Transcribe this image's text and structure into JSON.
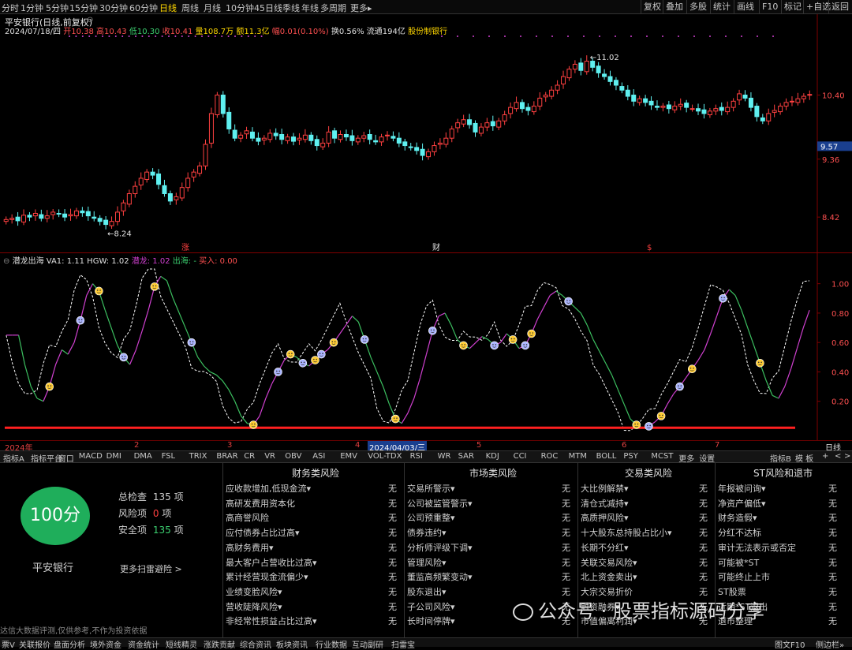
{
  "toolbar": {
    "periods": [
      "分时",
      "1分钟",
      "5分钟",
      "15分钟",
      "30分钟",
      "60分钟",
      "日线",
      "周线",
      "月线",
      "10分钟",
      "45日线",
      "季线",
      "年线",
      "多周期",
      "更多▸"
    ],
    "selected": "日线",
    "right_buttons": [
      "复权",
      "叠加",
      "多股",
      "统计",
      "画线",
      "F10",
      "标记",
      "+自选",
      "返回"
    ]
  },
  "quote": {
    "title": "平安银行(日线,前复权)",
    "date": "2024/07/18/四",
    "open": "开10.38",
    "high": "高10.43",
    "low": "低10.30",
    "close": "收10.41",
    "vol": "量108.7万",
    "amount": "额11.3亿",
    "change": "幅0.01(0.10%)",
    "turnover": "换0.56%",
    "float": "流通194亿",
    "sector": "股份制银行"
  },
  "price_axis": {
    "labels": [
      "10.40",
      "9.36",
      "8.42"
    ],
    "current": "9.57"
  },
  "annotations": {
    "max": "11.02",
    "min": "8.24",
    "events": [
      "涨",
      "财",
      "$"
    ]
  },
  "indicator": {
    "name": "潜龙出海",
    "va1": "VA1: 1.11",
    "hgw": "HGW: 1.02",
    "qianlong": "潜龙: 1.02",
    "chuhai": "出海: -",
    "buy": "买入: 0.00",
    "axis": [
      "1.00",
      "0.80",
      "0.60",
      "0.40",
      "0.20"
    ]
  },
  "xaxis": {
    "labels": [
      "2024年",
      "2",
      "3",
      "4",
      "2024/04/03/三",
      "5",
      "6",
      "7"
    ],
    "right": "日线"
  },
  "tabs": [
    "指标A",
    "指标平台",
    "窗口",
    "MACD",
    "DMI",
    "DMA",
    "FSL",
    "TRIX",
    "BRAR",
    "CR",
    "VR",
    "OBV",
    "ASI",
    "EMV",
    "VOL-TDX",
    "RSI",
    "WR",
    "SAR",
    "KDJ",
    "CCI",
    "ROC",
    "MTM",
    "BOLL",
    "PSY",
    "MCST",
    "更多",
    "设置"
  ],
  "tabs_right": [
    "指标B",
    "模 板",
    "+",
    "<",
    ">"
  ],
  "risk": {
    "score": "100分",
    "stock": "平安银行",
    "total_label": "总检查",
    "total": "135",
    "total_unit": "项",
    "risk_label": "风险项",
    "risk_count": "0",
    "risk_unit": "项",
    "safe_label": "安全项",
    "safe": "135",
    "safe_unit": "项",
    "more": "更多扫雷避险 >",
    "no": "无",
    "columns": [
      {
        "title": "财务类风险",
        "items": [
          "应收款增加,低现金流▾",
          "高研发费用资本化",
          "高商誉风险",
          "应付债券占比过高▾",
          "高财务费用▾",
          "最大客户占营收比过高▾",
          "累计经营现金流偏少▾",
          "业绩变脸风险▾",
          "营收陡降风险▾",
          "非经常性损益占比过高▾"
        ]
      },
      {
        "title": "市场类风险",
        "items": [
          "交易所警示▾",
          "公司被监管警示▾",
          "公司预重整▾",
          "债券违约▾",
          "分析师评级下调▾",
          "管理风险▾",
          "董监高频繁变动▾",
          "股东退出▾",
          "子公司风险▾",
          "长时间停牌▾"
        ]
      },
      {
        "title": "交易类风险",
        "items": [
          "大比例解禁▾",
          "清仓式减持▾",
          "高质押风险▾",
          "十大股东总持股占比小▾",
          "长期不分红▾",
          "关联交易风险▾",
          "北上资金卖出▾",
          "大宗交易折价",
          "融资融券▾",
          "市值偏离利润▾"
        ]
      },
      {
        "title": "ST风险和退市",
        "items": [
          "年报被问询▾",
          "净资产偏低▾",
          "财务造假▾",
          "分红不达标",
          "审计无法表示或否定",
          "可能被*ST",
          "可能终止上市",
          "ST股票",
          "近期*ST退出",
          "退市整理"
        ]
      }
    ]
  },
  "footer": {
    "disclaimer": "达信大数据评测,仅供参考,不作为投资依据",
    "items": [
      "票V",
      "关联报价",
      "盘面分析",
      "境外资金",
      "资金统计",
      "短线精灵",
      "涨跌贡献",
      "综合资讯",
      "板块资讯",
      "行业数据",
      "互动副研",
      "扫雷宝"
    ],
    "right": "图文F10",
    "right2": "侧边栏»"
  },
  "watermark": "公众号 · 股票指标源码分享",
  "chart_data": [
    {
      "type": "candlestick",
      "title": "平安银行(日线,前复权)",
      "ylim": [
        8.0,
        11.2
      ],
      "x": [
        "2024年",
        "2",
        "3",
        "4",
        "5",
        "6",
        "7"
      ],
      "y_ticks": [
        10.4,
        9.36,
        8.42
      ],
      "marked_high": 11.02,
      "marked_low": 8.24,
      "last_close": 10.41,
      "close": [
        8.38,
        8.4,
        8.36,
        8.45,
        8.42,
        8.48,
        8.4,
        8.44,
        8.5,
        8.47,
        8.42,
        8.46,
        8.52,
        8.49,
        8.44,
        8.4,
        8.35,
        8.3,
        8.35,
        8.5,
        8.65,
        8.8,
        8.92,
        9.05,
        9.15,
        9.1,
        8.95,
        8.8,
        8.68,
        8.75,
        8.9,
        9.05,
        9.15,
        9.25,
        9.6,
        10.1,
        10.4,
        10.1,
        9.85,
        9.7,
        9.75,
        9.82,
        9.7,
        9.65,
        9.7,
        9.78,
        9.74,
        9.68,
        9.72,
        9.65,
        9.7,
        9.75,
        9.66,
        9.58,
        9.62,
        9.8,
        9.7,
        9.76,
        9.72,
        9.66,
        9.7,
        9.74,
        9.68,
        9.64,
        9.72,
        9.75,
        9.7,
        9.62,
        9.58,
        9.55,
        9.5,
        9.42,
        9.48,
        9.58,
        9.62,
        9.7,
        9.85,
        9.95,
        10.0,
        9.92,
        9.8,
        9.88,
        9.95,
        9.9,
        9.98,
        10.08,
        10.2,
        10.28,
        10.18,
        10.15,
        10.22,
        10.35,
        10.4,
        10.48,
        10.56,
        10.7,
        10.82,
        10.9,
        10.8,
        10.95,
        10.85,
        10.76,
        10.7,
        10.62,
        10.56,
        10.48,
        10.38,
        10.3,
        10.34,
        10.28,
        10.24,
        10.2,
        10.22,
        10.18,
        10.22,
        10.25,
        10.2,
        10.18,
        10.14,
        10.1,
        10.14,
        10.18,
        10.15,
        10.2,
        10.3,
        10.42,
        10.35,
        10.2,
        10.05,
        9.98,
        10.1,
        10.15,
        10.22,
        10.28,
        10.3,
        10.34,
        10.38,
        10.41
      ]
    },
    {
      "type": "line",
      "title": "潜龙出海",
      "ylim": [
        0.0,
        1.1
      ],
      "y_ticks": [
        1.0,
        0.8,
        0.6,
        0.4,
        0.2
      ],
      "reference": 0.02,
      "series": [
        {
          "name": "VA1",
          "last": 1.11
        },
        {
          "name": "HGW",
          "last": 1.02
        },
        {
          "name": "潜龙",
          "last": 1.02
        }
      ],
      "values": [
        0.65,
        0.45,
        0.3,
        0.22,
        0.2,
        0.3,
        0.45,
        0.55,
        0.52,
        0.6,
        0.75,
        0.92,
        1.0,
        0.95,
        0.82,
        0.7,
        0.58,
        0.5,
        0.45,
        0.55,
        0.68,
        0.82,
        0.98,
        1.05,
        1.02,
        0.9,
        0.8,
        0.7,
        0.6,
        0.5,
        0.44,
        0.4,
        0.38,
        0.34,
        0.28,
        0.2,
        0.1,
        0.05,
        0.04,
        0.1,
        0.22,
        0.32,
        0.4,
        0.48,
        0.52,
        0.5,
        0.46,
        0.44,
        0.48,
        0.52,
        0.55,
        0.6,
        0.66,
        0.72,
        0.78,
        0.74,
        0.62,
        0.5,
        0.4,
        0.3,
        0.18,
        0.08,
        0.05,
        0.12,
        0.22,
        0.36,
        0.52,
        0.68,
        0.78,
        0.8,
        0.72,
        0.62,
        0.58,
        0.56,
        0.6,
        0.64,
        0.62,
        0.58,
        0.6,
        0.66,
        0.62,
        0.56,
        0.58,
        0.66,
        0.76,
        0.84,
        0.92,
        0.95,
        0.92,
        0.88,
        0.84,
        0.8,
        0.72,
        0.62,
        0.54,
        0.46,
        0.38,
        0.28,
        0.18,
        0.08,
        0.04,
        0.02,
        0.03,
        0.06,
        0.1,
        0.18,
        0.25,
        0.3,
        0.36,
        0.42,
        0.48,
        0.55,
        0.66,
        0.78,
        0.9,
        0.96,
        0.92,
        0.82,
        0.7,
        0.58,
        0.46,
        0.34,
        0.24,
        0.22,
        0.3,
        0.42,
        0.56,
        0.7,
        0.82,
        0.92,
        1.0
      ]
    }
  ]
}
